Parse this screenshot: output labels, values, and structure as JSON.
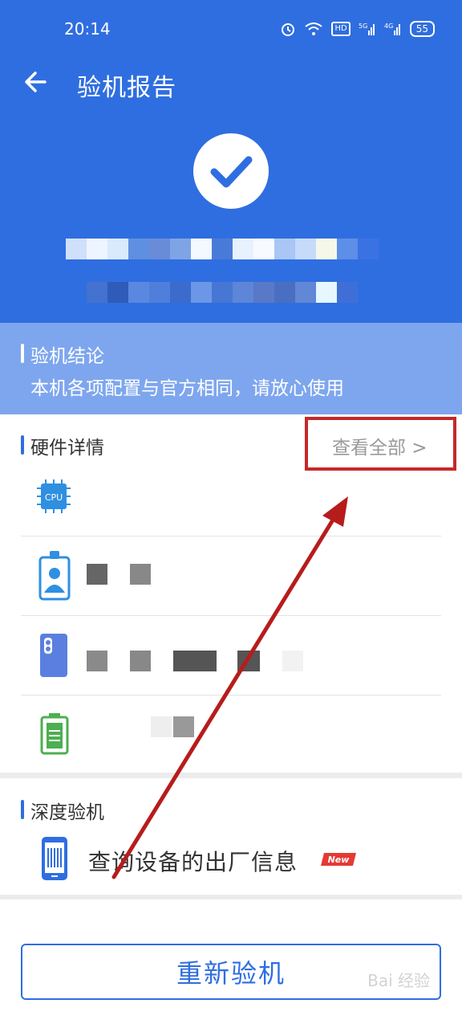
{
  "status_bar": {
    "time": "20:14",
    "battery": "55",
    "icons": [
      "alarm-icon",
      "wifi-icon",
      "hd-icon",
      "signal-5g-icon",
      "signal-4g-icon",
      "battery-icon"
    ]
  },
  "header": {
    "title": "验机报告",
    "back_icon": "back-arrow-icon",
    "check_icon": "check-icon"
  },
  "conclusion": {
    "title": "验机结论",
    "text": "本机各项配置与官方相同，请放心使用"
  },
  "hardware": {
    "title": "硬件详情",
    "view_all": "查看全部 >",
    "items": [
      {
        "icon": "cpu-icon",
        "icon_label": "CPU"
      },
      {
        "icon": "id-badge-icon"
      },
      {
        "icon": "phone-camera-icon"
      },
      {
        "icon": "battery-full-icon"
      }
    ]
  },
  "deep_check": {
    "title": "深度验机",
    "item_label": "查询设备的出厂信息",
    "item_icon": "barcode-phone-icon",
    "badge": "New"
  },
  "recheck_button": "重新验机",
  "watermark": "Bai 经验",
  "colors": {
    "primary": "#2f6ee0",
    "conclusion_bg": "#7ea6ee",
    "annotation_red": "#c62828"
  }
}
